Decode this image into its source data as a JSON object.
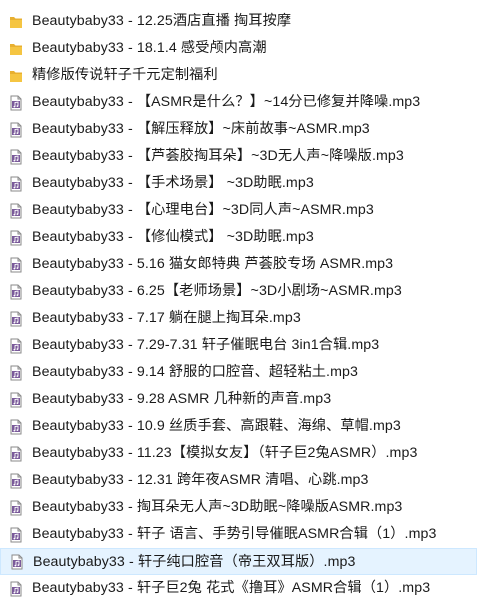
{
  "items": [
    {
      "type": "folder",
      "icon": "folder-icon",
      "name": "Beautybaby33 - 12.25酒店直播 掏耳按摩",
      "selected": false
    },
    {
      "type": "folder",
      "icon": "folder-icon",
      "name": "Beautybaby33 - 18.1.4 感受颅内高潮",
      "selected": false
    },
    {
      "type": "folder",
      "icon": "folder-icon",
      "name": "精修版传说轩子千元定制福利",
      "selected": false
    },
    {
      "type": "mp3",
      "icon": "audio-file-icon",
      "name": "Beautybaby33 - 【ASMR是什么？】~14分已修复并降噪.mp3",
      "selected": false
    },
    {
      "type": "mp3",
      "icon": "audio-file-icon",
      "name": "Beautybaby33 - 【解压释放】~床前故事~ASMR.mp3",
      "selected": false
    },
    {
      "type": "mp3",
      "icon": "audio-file-icon",
      "name": "Beautybaby33 - 【芦荟胶掏耳朵】~3D无人声~降噪版.mp3",
      "selected": false
    },
    {
      "type": "mp3",
      "icon": "audio-file-icon",
      "name": "Beautybaby33 - 【手术场景】 ~3D助眠.mp3",
      "selected": false
    },
    {
      "type": "mp3",
      "icon": "audio-file-icon",
      "name": "Beautybaby33 - 【心理电台】~3D同人声~ASMR.mp3",
      "selected": false
    },
    {
      "type": "mp3",
      "icon": "audio-file-icon",
      "name": "Beautybaby33 - 【修仙模式】 ~3D助眠.mp3",
      "selected": false
    },
    {
      "type": "mp3",
      "icon": "audio-file-icon",
      "name": "Beautybaby33 - 5.16 猫女郎特典 芦荟胶专场 ASMR.mp3",
      "selected": false
    },
    {
      "type": "mp3",
      "icon": "audio-file-icon",
      "name": "Beautybaby33 - 6.25【老师场景】~3D小剧场~ASMR.mp3",
      "selected": false
    },
    {
      "type": "mp3",
      "icon": "audio-file-icon",
      "name": "Beautybaby33 - 7.17 躺在腿上掏耳朵.mp3",
      "selected": false
    },
    {
      "type": "mp3",
      "icon": "audio-file-icon",
      "name": "Beautybaby33 - 7.29-7.31 轩子催眠电台 3in1合辑.mp3",
      "selected": false
    },
    {
      "type": "mp3",
      "icon": "audio-file-icon",
      "name": "Beautybaby33 - 9.14 舒服的口腔音、超轻粘土.mp3",
      "selected": false
    },
    {
      "type": "mp3",
      "icon": "audio-file-icon",
      "name": "Beautybaby33 - 9.28 ASMR 几种新的声音.mp3",
      "selected": false
    },
    {
      "type": "mp3",
      "icon": "audio-file-icon",
      "name": "Beautybaby33 - 10.9 丝质手套、高跟鞋、海绵、草帽.mp3",
      "selected": false
    },
    {
      "type": "mp3",
      "icon": "audio-file-icon",
      "name": "Beautybaby33 - 11.23【模拟女友】（轩子巨2兔ASMR）.mp3",
      "selected": false
    },
    {
      "type": "mp3",
      "icon": "audio-file-icon",
      "name": "Beautybaby33 - 12.31 跨年夜ASMR 清唱、心跳.mp3",
      "selected": false
    },
    {
      "type": "mp3",
      "icon": "audio-file-icon",
      "name": "Beautybaby33 - 掏耳朵无人声~3D助眠~降噪版ASMR.mp3",
      "selected": false
    },
    {
      "type": "mp3",
      "icon": "audio-file-icon",
      "name": "Beautybaby33 - 轩子 语言、手势引导催眠ASMR合辑（1）.mp3",
      "selected": false
    },
    {
      "type": "mp3",
      "icon": "audio-file-icon",
      "name": "Beautybaby33 - 轩子纯口腔音（帝王双耳版）.mp3",
      "selected": true
    },
    {
      "type": "mp3",
      "icon": "audio-file-icon",
      "name": "Beautybaby33 - 轩子巨2兔 花式《撸耳》ASMR合辑（1）.mp3",
      "selected": false
    }
  ],
  "colors": {
    "folder_fill": "#f5c542",
    "folder_tab": "#e8b030",
    "selected_bg": "#e5f3ff",
    "selected_border": "#cde8ff"
  }
}
